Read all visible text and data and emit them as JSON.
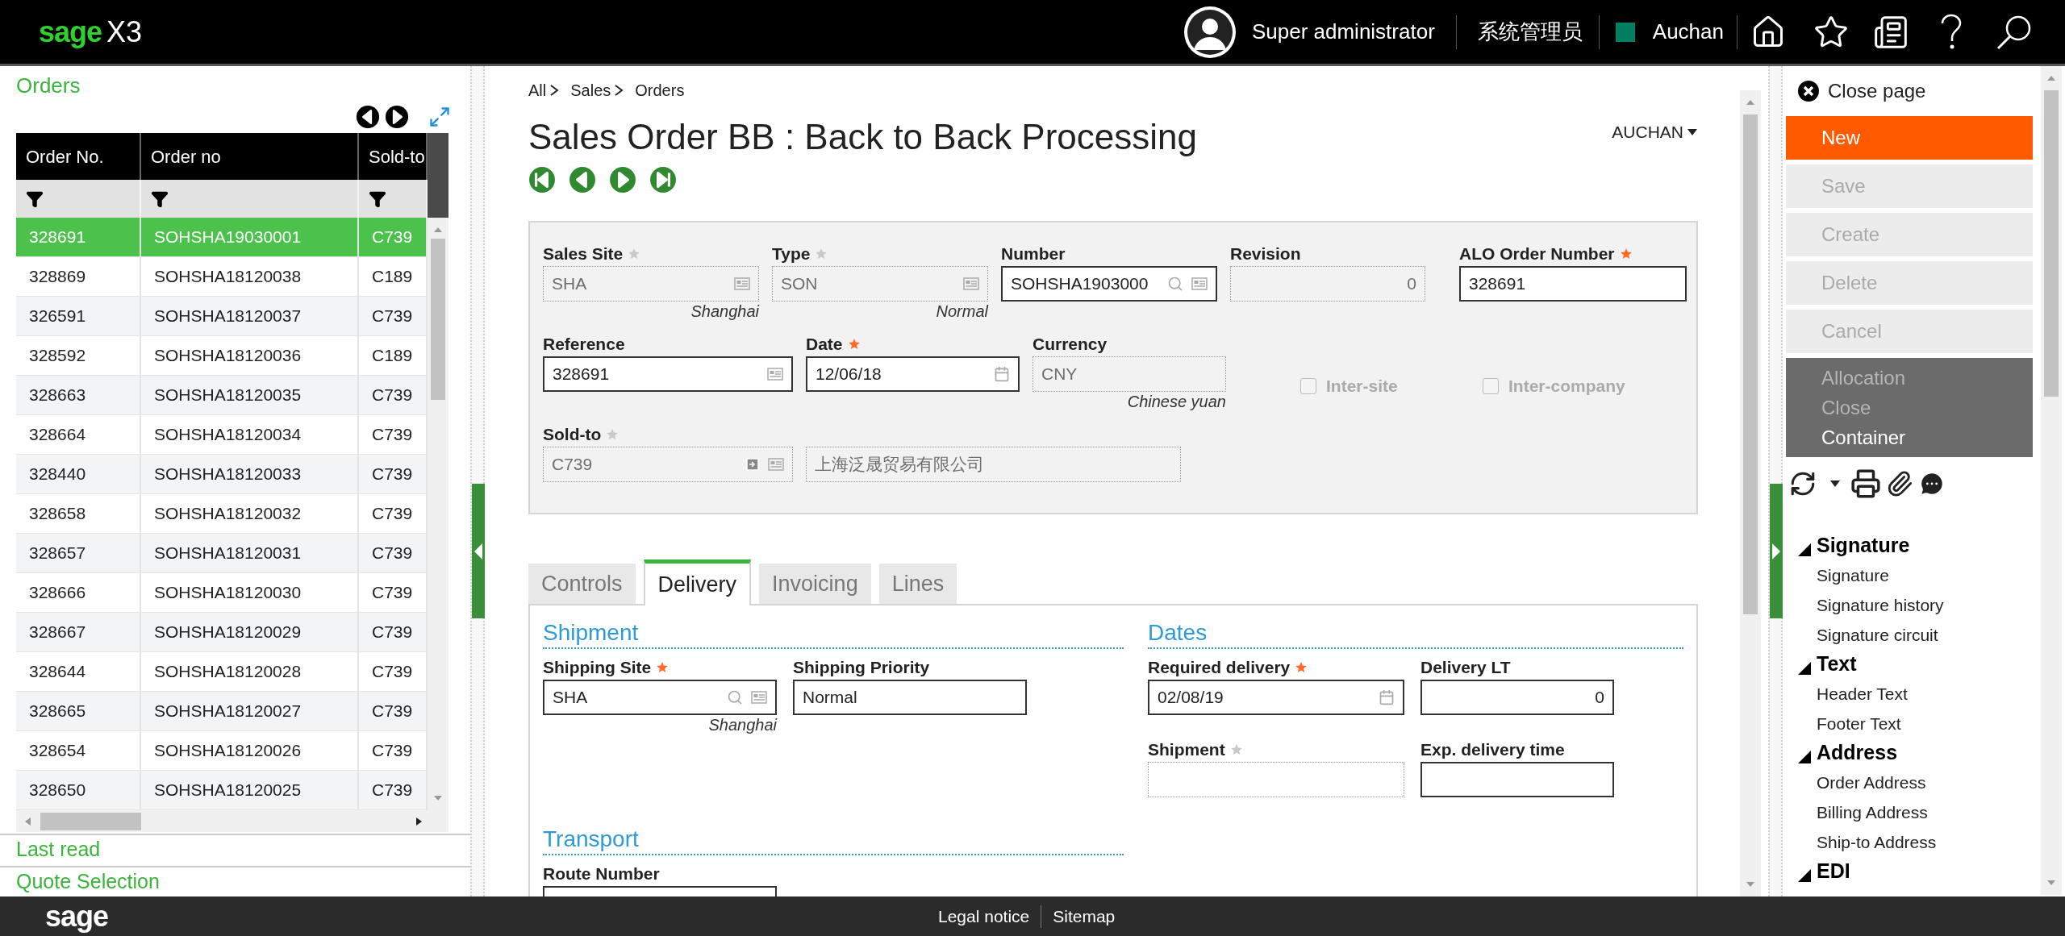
{
  "header": {
    "logo": {
      "brand": "sage",
      "product": "X3"
    },
    "user": "Super administrator",
    "role": "系统管理员",
    "company": "Auchan"
  },
  "left_panel": {
    "title": "Orders",
    "table": {
      "columns": [
        "Order No.",
        "Order no",
        "Sold-to"
      ],
      "rows": [
        {
          "cells": [
            "328691",
            "SOHSHA19030001",
            "C739"
          ],
          "selected": true
        },
        {
          "cells": [
            "328869",
            "SOHSHA18120038",
            "C189"
          ],
          "selected": false
        },
        {
          "cells": [
            "326591",
            "SOHSHA18120037",
            "C739"
          ],
          "selected": false
        },
        {
          "cells": [
            "328592",
            "SOHSHA18120036",
            "C189"
          ],
          "selected": false
        },
        {
          "cells": [
            "328663",
            "SOHSHA18120035",
            "C739"
          ],
          "selected": false
        },
        {
          "cells": [
            "328664",
            "SOHSHA18120034",
            "C739"
          ],
          "selected": false
        },
        {
          "cells": [
            "328440",
            "SOHSHA18120033",
            "C739"
          ],
          "selected": false
        },
        {
          "cells": [
            "328658",
            "SOHSHA18120032",
            "C739"
          ],
          "selected": false
        },
        {
          "cells": [
            "328657",
            "SOHSHA18120031",
            "C739"
          ],
          "selected": false
        },
        {
          "cells": [
            "328666",
            "SOHSHA18120030",
            "C739"
          ],
          "selected": false
        },
        {
          "cells": [
            "328667",
            "SOHSHA18120029",
            "C739"
          ],
          "selected": false
        },
        {
          "cells": [
            "328644",
            "SOHSHA18120028",
            "C739"
          ],
          "selected": false
        },
        {
          "cells": [
            "328665",
            "SOHSHA18120027",
            "C739"
          ],
          "selected": false
        },
        {
          "cells": [
            "328654",
            "SOHSHA18120026",
            "C739"
          ],
          "selected": false
        },
        {
          "cells": [
            "328650",
            "SOHSHA18120025",
            "C739"
          ],
          "selected": false
        }
      ]
    },
    "sections": [
      "Last read",
      "Quote Selection"
    ]
  },
  "main": {
    "breadcrumb": [
      "All",
      "Sales",
      "Orders"
    ],
    "title": "Sales Order BB : Back to Back Processing",
    "company_selector": "AUCHAN",
    "header_rows": [
      {
        "fields": [
          {
            "kind": "select",
            "label": "Sales Site",
            "star": true,
            "required": false,
            "value": "SHA",
            "disabled": true,
            "description": "Shanghai"
          },
          {
            "kind": "select",
            "label": "Type",
            "star": true,
            "required": false,
            "value": "SON",
            "disabled": true,
            "description": "Normal"
          },
          {
            "kind": "lookup",
            "label": "Number",
            "value": "SOHSHA1903000",
            "disabled": false
          },
          {
            "kind": "numeric",
            "label": "Revision",
            "value": "0",
            "disabled": true
          },
          {
            "kind": "plain",
            "label": "ALO Order Number",
            "star": true,
            "required": true,
            "value": "328691",
            "disabled": false
          }
        ]
      },
      {
        "fields": [
          {
            "kind": "select",
            "label": "Reference",
            "value": "328691",
            "disabled": false
          },
          {
            "kind": "date",
            "label": "Date",
            "star": true,
            "required": true,
            "value": "12/06/18",
            "disabled": false
          },
          {
            "kind": "plain",
            "label": "Currency",
            "value": "CNY",
            "disabled": true,
            "description": "Chinese yuan"
          },
          {
            "kind": "checkbox",
            "label": "Inter-site",
            "checked": false,
            "disabled": true
          },
          {
            "kind": "checkbox",
            "label": "Inter-company",
            "checked": false,
            "disabled": true
          }
        ]
      },
      {
        "fields": [
          {
            "kind": "link",
            "label": "Sold-to",
            "star": true,
            "required": false,
            "value": "C739",
            "disabled": true
          },
          {
            "kind": "plain",
            "value": "上海泛晟贸易有限公司",
            "disabled": true
          }
        ]
      }
    ],
    "tabs": [
      {
        "label": "Controls",
        "selected": false
      },
      {
        "label": "Delivery",
        "selected": true
      },
      {
        "label": "Invoicing",
        "selected": false
      },
      {
        "label": "Lines",
        "selected": false
      }
    ],
    "sections": [
      {
        "title": "Shipment",
        "rows": [
          {
            "fields": [
              {
                "kind": "lookup",
                "label": "Shipping Site",
                "star": true,
                "required": true,
                "value": "SHA",
                "disabled": false,
                "description": "Shanghai"
              },
              {
                "kind": "plain",
                "label": "Shipping Priority",
                "value": "Normal",
                "disabled": false
              }
            ]
          }
        ]
      },
      {
        "title": "Dates",
        "rows": [
          {
            "fields": [
              {
                "kind": "date",
                "label": "Required delivery",
                "star": true,
                "required": true,
                "value": "02/08/19",
                "disabled": false
              },
              {
                "kind": "numeric",
                "label": "Delivery LT",
                "value": "0",
                "disabled": false
              }
            ]
          },
          {
            "fields": [
              {
                "kind": "plain",
                "label": "Shipment",
                "star": true,
                "required": false,
                "disabled": true
              },
              {
                "kind": "plain",
                "label": "Exp. delivery time",
                "disabled": false
              }
            ]
          }
        ]
      },
      {
        "title": "Transport",
        "rows": [
          {
            "fields": [
              {
                "kind": "plain",
                "label": "Route Number",
                "disabled": false
              }
            ]
          }
        ]
      }
    ]
  },
  "right_panel": {
    "close": "Close page",
    "actions": [
      {
        "label": "New",
        "kind": "primary",
        "disabled": false
      },
      {
        "label": "Save",
        "kind": "button",
        "disabled": true
      },
      {
        "label": "Create",
        "kind": "button",
        "disabled": true
      },
      {
        "label": "Delete",
        "kind": "button",
        "disabled": true
      },
      {
        "label": "Cancel",
        "kind": "button",
        "disabled": true
      }
    ],
    "menu": [
      {
        "label": "Allocation",
        "disabled": true
      },
      {
        "label": "Close",
        "disabled": true
      },
      {
        "label": "Container",
        "disabled": false
      }
    ],
    "links": [
      {
        "label": "Signature",
        "expanded": true,
        "children": [
          {
            "label": "Signature"
          },
          {
            "label": "Signature history"
          },
          {
            "label": "Signature circuit"
          }
        ]
      },
      {
        "label": "Text",
        "expanded": true,
        "children": [
          {
            "label": "Header Text"
          },
          {
            "label": "Footer Text"
          }
        ]
      },
      {
        "label": "Address",
        "expanded": true,
        "children": [
          {
            "label": "Order Address"
          },
          {
            "label": "Billing Address"
          },
          {
            "label": "Ship-to Address"
          }
        ]
      },
      {
        "label": "EDI",
        "expanded": true
      }
    ]
  },
  "footer": {
    "logo": "sage",
    "links": [
      "Legal notice",
      "Sitemap"
    ]
  }
}
